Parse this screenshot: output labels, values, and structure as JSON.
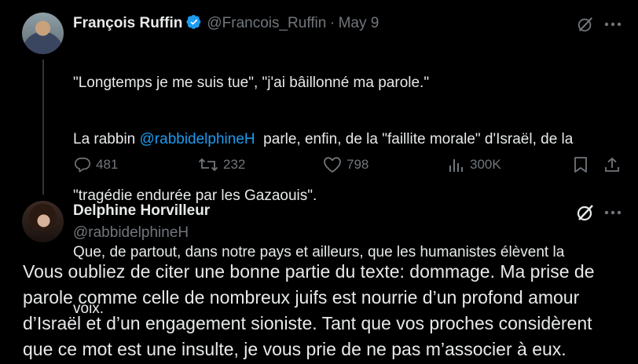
{
  "tweet": {
    "author_name": "François Ruffin",
    "author_handle": "@Francois_Ruffin",
    "separator": "·",
    "date": "May 9",
    "text_line1": "\"Longtemps je me suis tue\", \"j'ai bâillonné ma parole.\"",
    "text_line2_prefix": "La rabbin ",
    "mention": "@rabbidelphineH",
    "text_line2_suffix": "  parle, enfin, de la \"faillite morale\" d'Israël, de la",
    "text_line3": "\"tragédie endurée par les Gazaouis\".",
    "text_line4": "Que, de partout, dans notre pays et ailleurs, que les humanistes élèvent la",
    "text_line5": "voix.",
    "stats": {
      "replies": "481",
      "reposts": "232",
      "likes": "798",
      "views": "300K"
    }
  },
  "reply": {
    "author_name": "Delphine Horvilleur",
    "author_handle": "@rabbidelphineH",
    "text_line1": "Vous oubliez de citer une bonne partie du texte: dommage. Ma prise de",
    "text_line2": "parole comme celle de nombreux juifs est nourrie d’un profond amour",
    "text_line3": "d’Israël et d’un engagement sioniste. Tant que vos proches considèrent",
    "text_line4": "que ce mot est une insulte, je vous prie de ne pas m’associer à eux."
  },
  "icons": {
    "verified": "verified-badge-icon",
    "grok": "grok-icon",
    "more": "more-icon",
    "reply": "reply-icon",
    "repost": "repost-icon",
    "like": "like-icon",
    "views": "views-icon",
    "bookmark": "bookmark-icon",
    "share": "share-icon"
  },
  "colors": {
    "background": "#000000",
    "text": "#e7e9ea",
    "muted": "#71767b",
    "accent": "#1d9bf0"
  }
}
